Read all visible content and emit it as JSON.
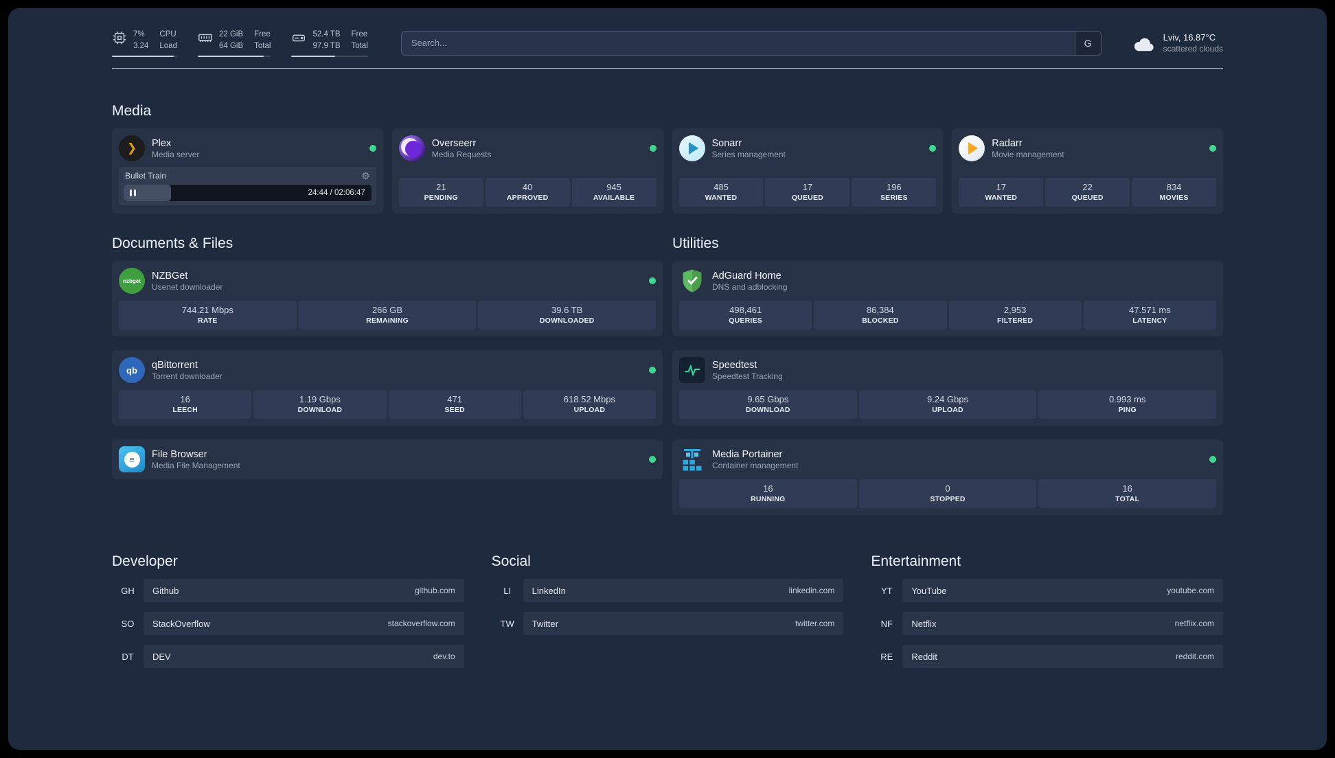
{
  "topbar": {
    "cpu": {
      "value1": "7%",
      "value2": "3.24",
      "label1": "CPU",
      "label2": "Load",
      "bar_percent": 95
    },
    "memory": {
      "value1": "22 GiB",
      "value2": "64 GiB",
      "label1": "Free",
      "label2": "Total",
      "bar_percent": 90
    },
    "disk": {
      "value1": "52.4 TB",
      "value2": "97.9 TB",
      "label1": "Free",
      "label2": "Total",
      "bar_percent": 57
    },
    "search": {
      "placeholder": "Search...",
      "provider_label": "G"
    },
    "weather": {
      "location": "Lviv, 16.87°C",
      "condition": "scattered clouds"
    }
  },
  "media": {
    "title": "Media",
    "plex": {
      "name": "Plex",
      "desc": "Media server",
      "now_playing": "Bullet Train",
      "time": "24:44 / 02:06:47",
      "progress_percent": 19
    },
    "overseerr": {
      "name": "Overseerr",
      "desc": "Media Requests",
      "stats": [
        {
          "value": "21",
          "label": "PENDING"
        },
        {
          "value": "40",
          "label": "APPROVED"
        },
        {
          "value": "945",
          "label": "AVAILABLE"
        }
      ]
    },
    "sonarr": {
      "name": "Sonarr",
      "desc": "Series management",
      "stats": [
        {
          "value": "485",
          "label": "WANTED"
        },
        {
          "value": "17",
          "label": "QUEUED"
        },
        {
          "value": "196",
          "label": "SERIES"
        }
      ]
    },
    "radarr": {
      "name": "Radarr",
      "desc": "Movie management",
      "stats": [
        {
          "value": "17",
          "label": "WANTED"
        },
        {
          "value": "22",
          "label": "QUEUED"
        },
        {
          "value": "834",
          "label": "MOVIES"
        }
      ]
    }
  },
  "documents": {
    "title": "Documents & Files",
    "nzbget": {
      "name": "NZBGet",
      "desc": "Usenet downloader",
      "icon_text": "nzbget",
      "stats": [
        {
          "value": "744.21 Mbps",
          "label": "RATE"
        },
        {
          "value": "266 GB",
          "label": "REMAINING"
        },
        {
          "value": "39.6 TB",
          "label": "DOWNLOADED"
        }
      ]
    },
    "qbittorrent": {
      "name": "qBittorrent",
      "desc": "Torrent downloader",
      "icon_text": "qb",
      "stats": [
        {
          "value": "16",
          "label": "LEECH"
        },
        {
          "value": "1.19 Gbps",
          "label": "DOWNLOAD"
        },
        {
          "value": "471",
          "label": "SEED"
        },
        {
          "value": "618.52 Mbps",
          "label": "UPLOAD"
        }
      ]
    },
    "filebrowser": {
      "name": "File Browser",
      "desc": "Media File Management",
      "icon_text": "≡"
    }
  },
  "utilities": {
    "title": "Utilities",
    "adguard": {
      "name": "AdGuard Home",
      "desc": "DNS and adblocking",
      "stats": [
        {
          "value": "498,461",
          "label": "QUERIES"
        },
        {
          "value": "86,384",
          "label": "BLOCKED"
        },
        {
          "value": "2,953",
          "label": "FILTERED"
        },
        {
          "value": "47.571 ms",
          "label": "LATENCY"
        }
      ]
    },
    "speedtest": {
      "name": "Speedtest",
      "desc": "Speedtest Tracking",
      "stats": [
        {
          "value": "9.65 Gbps",
          "label": "DOWNLOAD"
        },
        {
          "value": "9.24 Gbps",
          "label": "UPLOAD"
        },
        {
          "value": "0.993 ms",
          "label": "PING"
        }
      ]
    },
    "portainer": {
      "name": "Media Portainer",
      "desc": "Container management",
      "stats": [
        {
          "value": "16",
          "label": "RUNNING"
        },
        {
          "value": "0",
          "label": "STOPPED"
        },
        {
          "value": "16",
          "label": "TOTAL"
        }
      ]
    }
  },
  "bookmarks": {
    "developer": {
      "title": "Developer",
      "items": [
        {
          "abbr": "GH",
          "name": "Github",
          "url": "github.com"
        },
        {
          "abbr": "SO",
          "name": "StackOverflow",
          "url": "stackoverflow.com"
        },
        {
          "abbr": "DT",
          "name": "DEV",
          "url": "dev.to"
        }
      ]
    },
    "social": {
      "title": "Social",
      "items": [
        {
          "abbr": "LI",
          "name": "LinkedIn",
          "url": "linkedin.com"
        },
        {
          "abbr": "TW",
          "name": "Twitter",
          "url": "twitter.com"
        }
      ]
    },
    "entertainment": {
      "title": "Entertainment",
      "items": [
        {
          "abbr": "YT",
          "name": "YouTube",
          "url": "youtube.com"
        },
        {
          "abbr": "NF",
          "name": "Netflix",
          "url": "netflix.com"
        },
        {
          "abbr": "RE",
          "name": "Reddit",
          "url": "reddit.com"
        }
      ]
    }
  },
  "colors": {
    "status_green": "#3dd68c",
    "page_bg": "#1e2a3d",
    "accent_blue": "#2ea3e8"
  }
}
